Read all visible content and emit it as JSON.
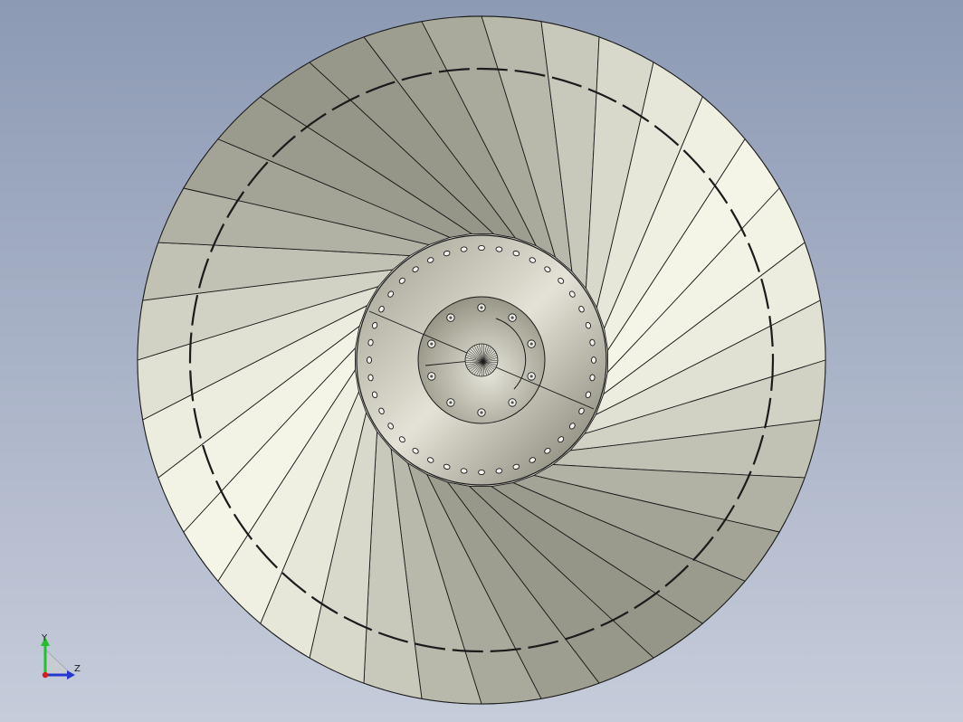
{
  "viewport": {
    "background_top": "#8c9ab4",
    "background_bottom": "#c6ccda"
  },
  "model": {
    "part": "fan-rotor",
    "blade_count": 36,
    "inner_bolt_hole_count": 10,
    "outer_bolt_hole_count": 40,
    "colors": {
      "blade_light": "#f4f3ea",
      "blade_dark": "#6f7060",
      "edge": "#1b1b1b",
      "hub_light": "#dedcd0",
      "hub_dark": "#767566"
    }
  },
  "triad": {
    "y_label": "Y",
    "z_label": "Z",
    "y_color": "#22c02a",
    "z_color": "#2438d0",
    "x_color": "#d41e1e"
  }
}
